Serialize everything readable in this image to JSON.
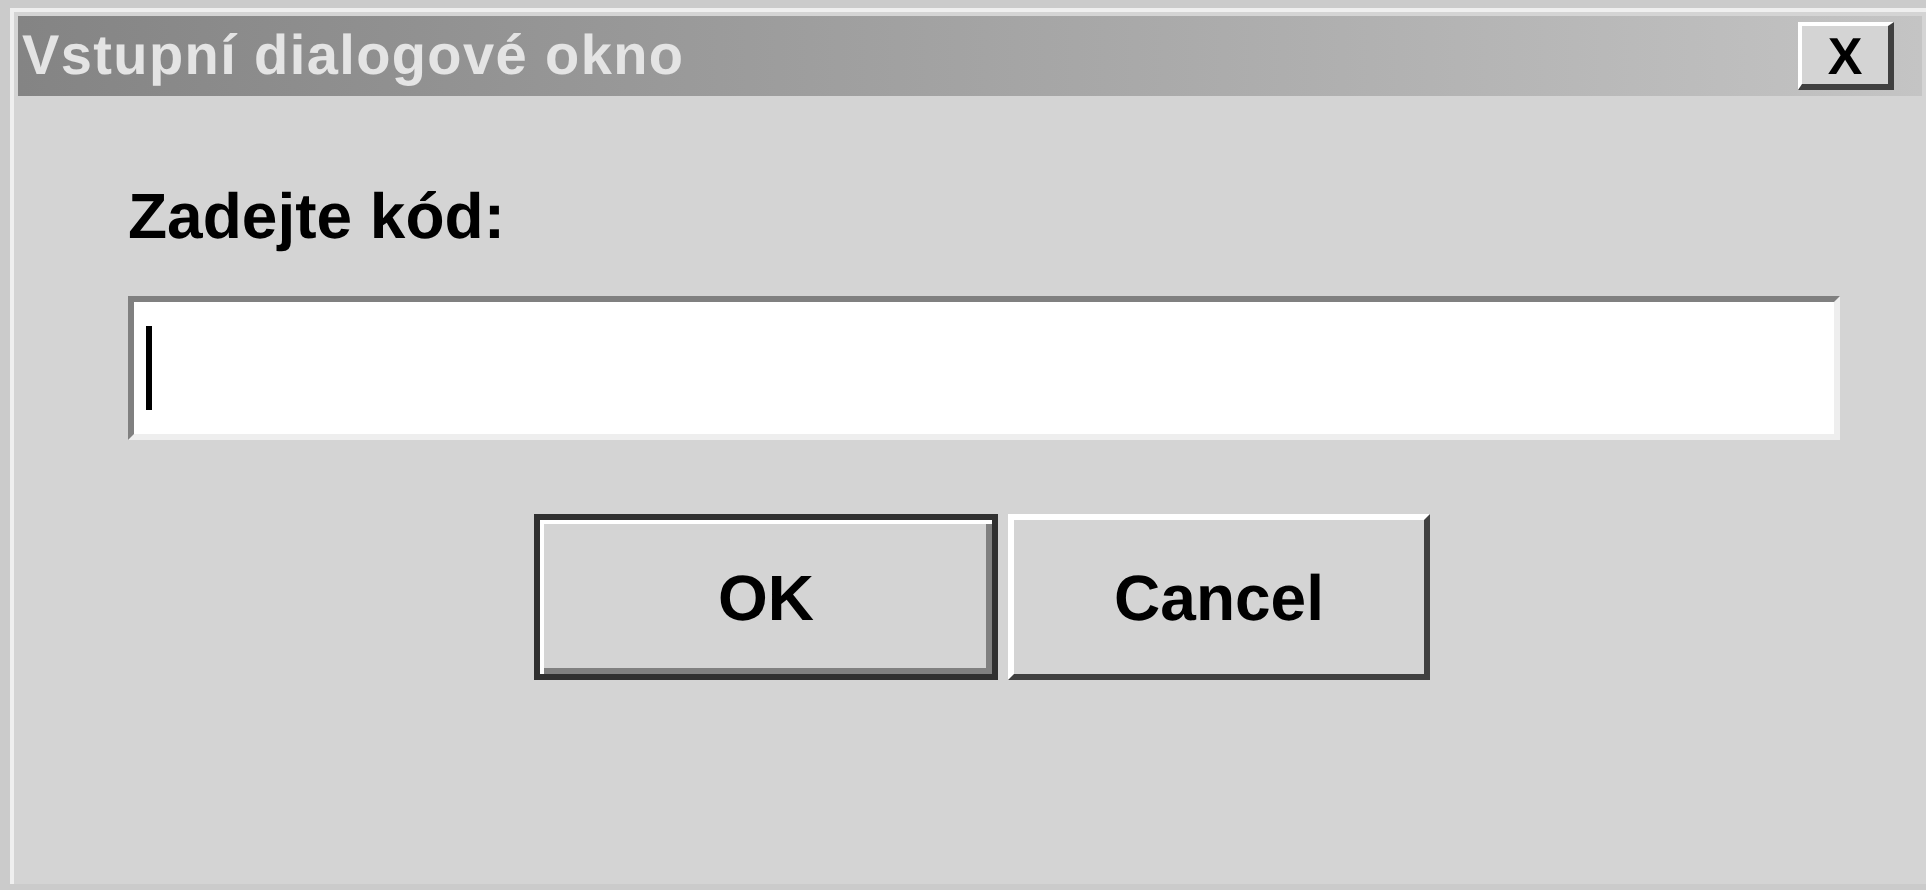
{
  "window": {
    "title": "Vstupní dialogové okno",
    "close": "X"
  },
  "prompt": {
    "label": "Zadejte kód:"
  },
  "input": {
    "focused": true
  },
  "buttons": [
    {
      "label": "OK",
      "default": true
    },
    {
      "label": "Cancel",
      "default": false
    }
  ]
}
